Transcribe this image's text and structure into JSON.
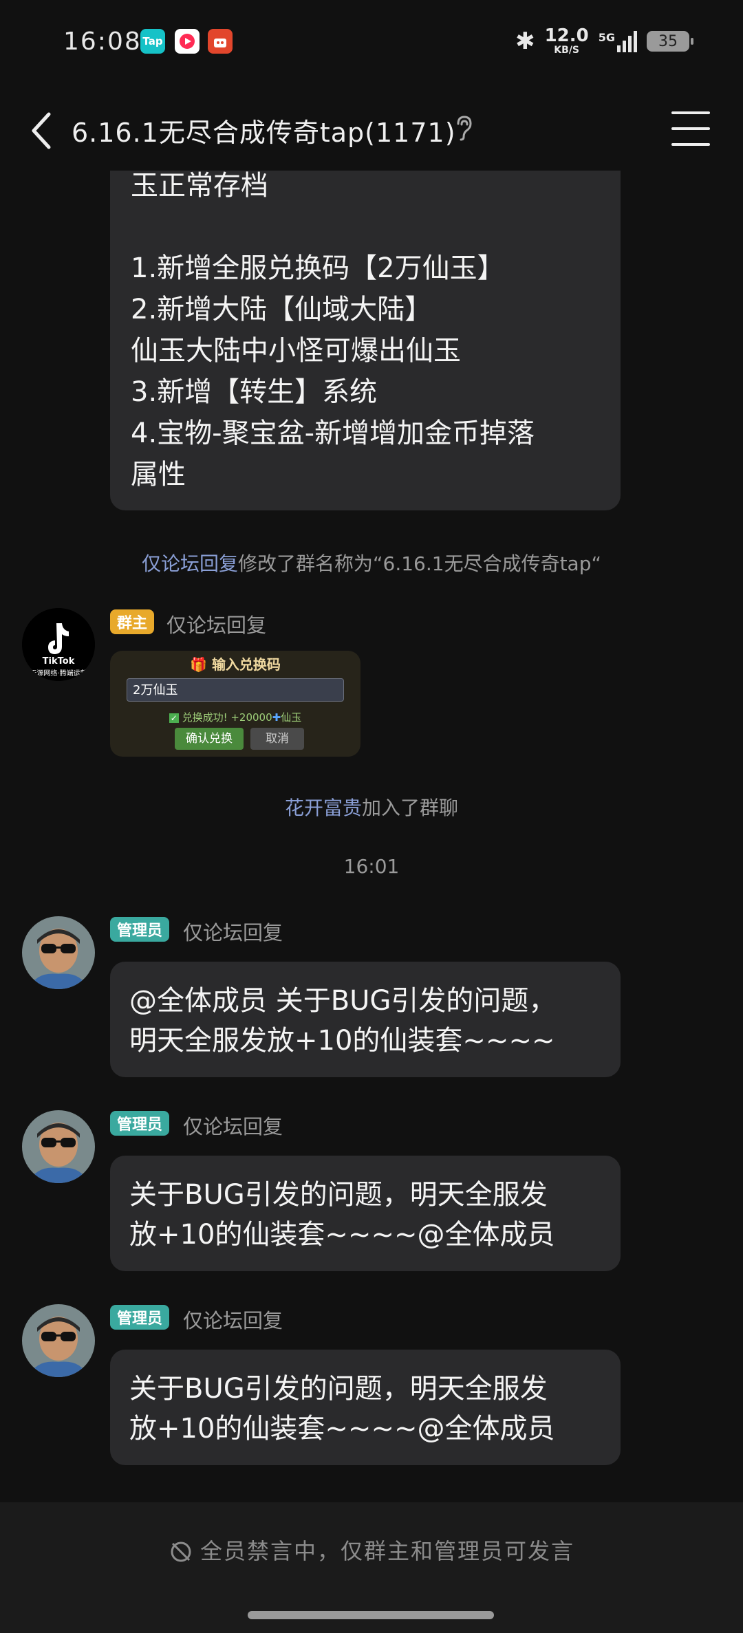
{
  "status_bar": {
    "time": "16:08",
    "app_icons": [
      {
        "name": "taptap-icon",
        "label": "Tap",
        "color": "#16c2c7"
      },
      {
        "name": "video-app-icon",
        "label": "",
        "color": "#ffffff"
      },
      {
        "name": "shop-app-icon",
        "label": "",
        "color": "#e2462c"
      }
    ],
    "net_speed_value": "12.0",
    "net_speed_unit": "KB/S",
    "network": "5G",
    "battery": "35"
  },
  "header": {
    "title": "6.16.1无尽合成传奇tap(1171)"
  },
  "top_message": {
    "lines": [
      "玉正常存档",
      "",
      "1.新增全服兑换码【2万仙玉】",
      "2.新增大陆【仙域大陆】",
      "仙玉大陆中小怪可爆出仙玉",
      "3.新增【转生】系统",
      "4.宝物-聚宝盆-新增增加金币掉落",
      "属性"
    ]
  },
  "system_messages": {
    "rename_name": "仅论坛回复",
    "rename_text": "修改了群名称为“6.16.1无尽合成传奇tap“",
    "join_name": "花开富贵",
    "join_text": "加入了群聊",
    "timestamp": "16:01"
  },
  "owner_message": {
    "badge": "群主",
    "sender": "仅论坛回复",
    "avatar_brand": "TikTok",
    "avatar_caption": "天源网络·腾端运营",
    "redeem": {
      "title": "输入兑换码",
      "input_value": "2万仙玉",
      "success_text": "兑换成功! +20000",
      "success_unit": "仙玉",
      "confirm": "确认兑换",
      "cancel": "取消"
    }
  },
  "admin_messages": [
    {
      "badge": "管理员",
      "sender": "仅论坛回复",
      "lines": [
        "@全体成员 关于BUG引发的问题，",
        "明天全服发放+10的仙装套~~~~"
      ]
    },
    {
      "badge": "管理员",
      "sender": "仅论坛回复",
      "lines": [
        "关于BUG引发的问题，明天全服发",
        "放+10的仙装套~~~~@全体成员"
      ]
    },
    {
      "badge": "管理员",
      "sender": "仅论坛回复",
      "lines": [
        "关于BUG引发的问题，明天全服发",
        "放+10的仙装套~~~~@全体成员"
      ]
    }
  ],
  "footer": {
    "mute_notice": "全员禁言中，仅群主和管理员可发言"
  },
  "colors": {
    "owner_badge": "#e8a92b",
    "admin_badge": "#3aa99f",
    "link_name": "#8a9fd6",
    "bubble": "#2a2a2c",
    "background": "#111111"
  }
}
